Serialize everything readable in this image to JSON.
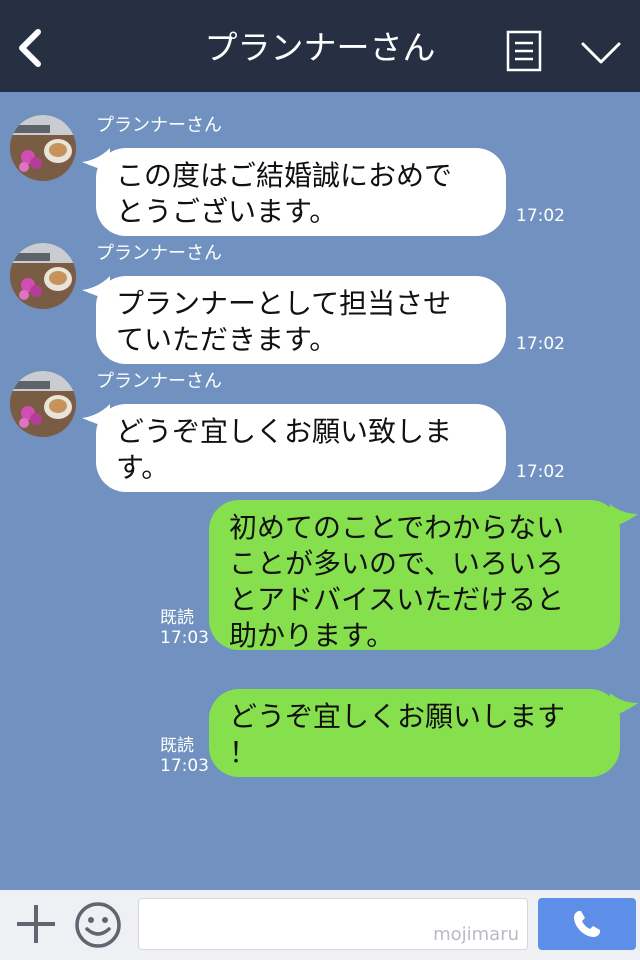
{
  "header": {
    "title": "プランナーさん",
    "back_icon": "chevron-left-icon",
    "menu_icon": "list-icon",
    "expand_icon": "chevron-down-icon",
    "background": "#263042"
  },
  "chat": {
    "background": "#7192c0",
    "incoming": [
      {
        "sender": "プランナーさん",
        "text": "この度はご結婚誠におめで\nとうございます。",
        "time": "17:02"
      },
      {
        "sender": "プランナーさん",
        "text": "プランナーとして担当させ\nていただきます。",
        "time": "17:02"
      },
      {
        "sender": "プランナーさん",
        "text": "どうぞ宜しくお願い致しま\nす。",
        "time": "17:02"
      }
    ],
    "outgoing": [
      {
        "text": "初めてのことでわからない\nことが多いので、いろいろ\nとアドバイスいただけると\n助かります。",
        "read": "既読",
        "time": "17:03"
      },
      {
        "text": "どうぞ宜しくお願いします\n！",
        "read": "既読",
        "time": "17:03"
      }
    ],
    "incoming_bubble_color": "#ffffff",
    "outgoing_bubble_color": "#86e04d"
  },
  "input_bar": {
    "plus_icon": "plus-icon",
    "emoji_icon": "smiley-icon",
    "watermark": "mojimaru",
    "send_icon": "phone-icon",
    "send_color": "#5d8fe8"
  }
}
